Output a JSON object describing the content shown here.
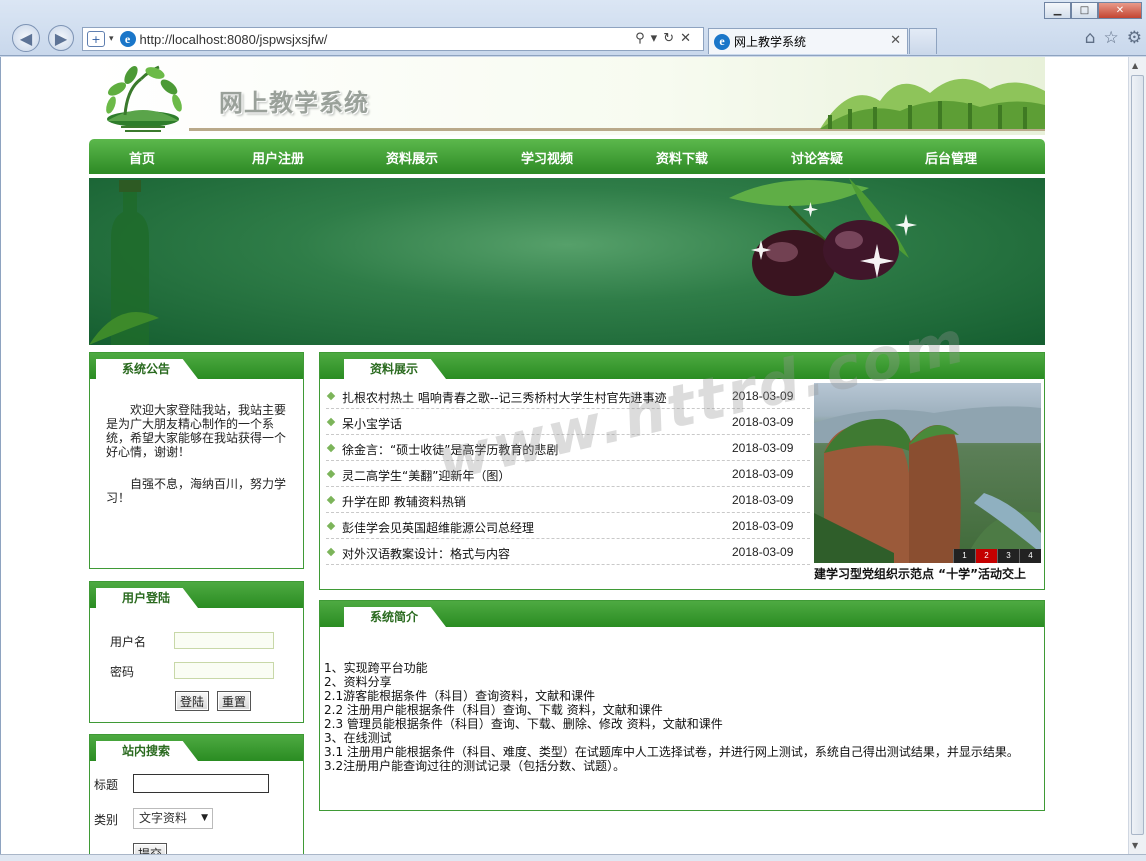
{
  "browser": {
    "url": "http://localhost:8080/jspwsjxsjfw/",
    "tab_title": "网上教学系统",
    "window_controls": [
      "minimize",
      "maximize",
      "close"
    ],
    "nav_icons": [
      "back-icon",
      "forward-icon"
    ],
    "address_icons": [
      "search-icon",
      "dropdown-icon",
      "refresh-icon",
      "stop-icon"
    ],
    "right_icons": [
      "home-icon",
      "star-icon",
      "gear-icon"
    ]
  },
  "header": {
    "site_title": "网上教学系统"
  },
  "nav": {
    "items": [
      "首页",
      "用户注册",
      "资料展示",
      "学习视频",
      "资料下载",
      "讨论答疑",
      "后台管理"
    ]
  },
  "notice": {
    "title": "系统公告",
    "paragraphs": [
      "欢迎大家登陆我站，我站主要是为广大朋友精心制作的一个系统，希望大家能够在我站获得一个好心情，谢谢！",
      "自强不息，海纳百川，努力学习！"
    ]
  },
  "login": {
    "title": "用户登陆",
    "username_label": "用户名",
    "password_label": "密码",
    "login_button": "登陆",
    "reset_button": "重置"
  },
  "search": {
    "title": "站内搜索",
    "title_label": "标题",
    "type_label": "类别",
    "type_selected": "文字资料",
    "submit_button": "提交"
  },
  "resources": {
    "title": "资料展示",
    "items": [
      {
        "title": "扎根农村热土 唱响青春之歌--记三秀桥村大学生村官先进事迹",
        "date": "2018-03-09"
      },
      {
        "title": "呆小宝学话",
        "date": "2018-03-09"
      },
      {
        "title": "徐金言：“硕士收徒”是高学历教育的悲剧",
        "date": "2018-03-09"
      },
      {
        "title": "灵二高学生“美翻”迎新年（图）",
        "date": "2018-03-09"
      },
      {
        "title": "升学在即 教辅资料热销",
        "date": "2018-03-09"
      },
      {
        "title": "彭佳学会见英国超维能源公司总经理",
        "date": "2018-03-09"
      },
      {
        "title": "对外汉语教案设计：格式与内容",
        "date": "2018-03-09"
      }
    ],
    "slide_caption": "建学习型党组织示范点 “十学”活动交上",
    "pager": [
      "1",
      "2",
      "3",
      "4"
    ],
    "pager_active": "2"
  },
  "intro": {
    "title": "系统简介",
    "lines": [
      "1、实现跨平台功能",
      "2、资料分享",
      "2.1游客能根据条件（科目）查询资料，文献和课件",
      "2.2 注册用户能根据条件（科目）查询、下载 资料，文献和课件",
      "2.3 管理员能根据条件（科目）查询、下载、删除、修改 资料，文献和课件",
      "3、在线测试",
      "3.1 注册用户能根据条件（科目、难度、类型）在试题库中人工选择试卷，并进行网上测试，系统自己得出测试结果，并显示结果。",
      "3.2注册用户能查询过往的测试记录（包括分数、试题）。"
    ]
  },
  "watermark": "www.httrd.com",
  "colors": {
    "nav_green": "#3c9a32",
    "panel_border": "#3f9a36",
    "pager_active": "#c40000"
  }
}
